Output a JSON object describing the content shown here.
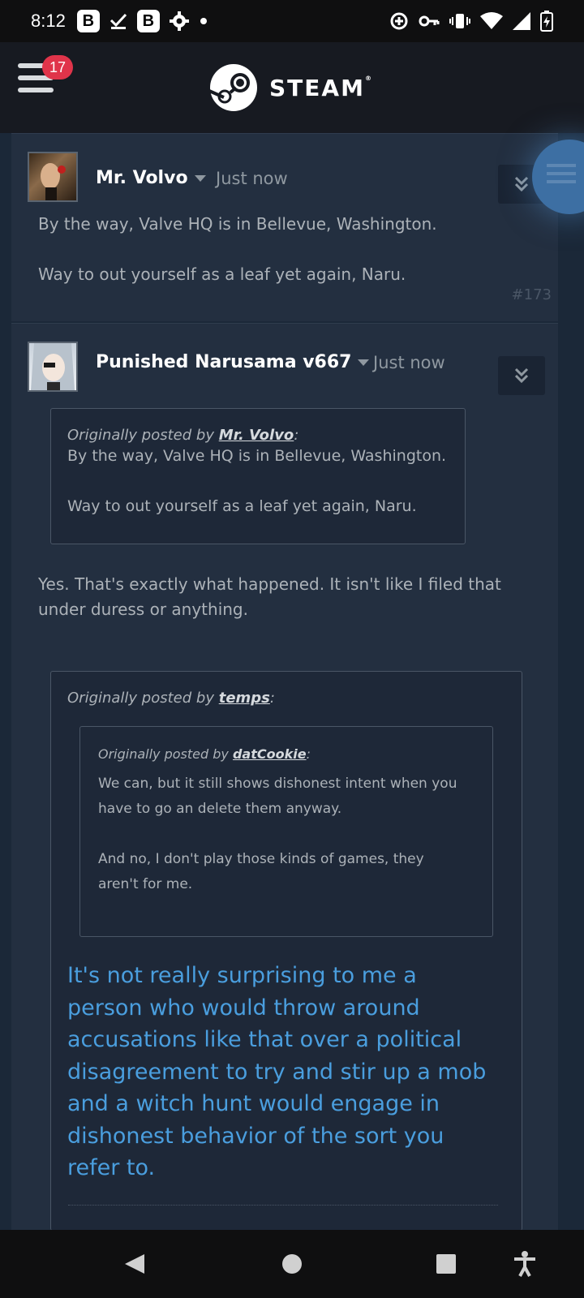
{
  "status_bar": {
    "time": "8:12",
    "b1": "B",
    "b2": "B"
  },
  "header": {
    "brand": "STEAM",
    "notification_count": "17"
  },
  "posts": [
    {
      "author": "Mr. Volvo",
      "time": "Just now",
      "lines": [
        "By the way, Valve HQ is in Bellevue, Washington.",
        "Way to out yourself as a leaf yet again, Naru."
      ],
      "number": "#173"
    },
    {
      "author": "Punished Narusama v667",
      "time": "Just now",
      "quote1": {
        "prefix": "Originally posted by ",
        "author": "Mr. Volvo",
        "suffix": ":",
        "lines": [
          "By the way, Valve HQ is in Bellevue, Washington.",
          "Way to out yourself as a leaf yet again, Naru."
        ]
      },
      "reply": [
        "Yes. That's exactly what happened. It isn't like I filed that",
        "under duress or anything."
      ],
      "quote2": {
        "prefix": "Originally posted by ",
        "author": "temps",
        "suffix": ":",
        "inner": {
          "prefix": "Originally posted by ",
          "author": "datCookie",
          "suffix": ":",
          "lines": [
            "We can, but it still shows dishonest intent when you",
            "have to go an delete them anyway.",
            "And no, I don't play those kinds of games, they",
            "aren't for me."
          ]
        },
        "big_lines": [
          "It's not really surprising to me a",
          "person who would throw around",
          "accusations like that over a political",
          "disagreement to try and stir up a mob",
          "and a witch hunt would engage in",
          "dishonest behavior of the sort you",
          "refer to."
        ]
      }
    }
  ],
  "colors": {
    "accent_blue": "#4a9ede",
    "badge_red": "#e0344a",
    "bg": "#1b2838"
  }
}
